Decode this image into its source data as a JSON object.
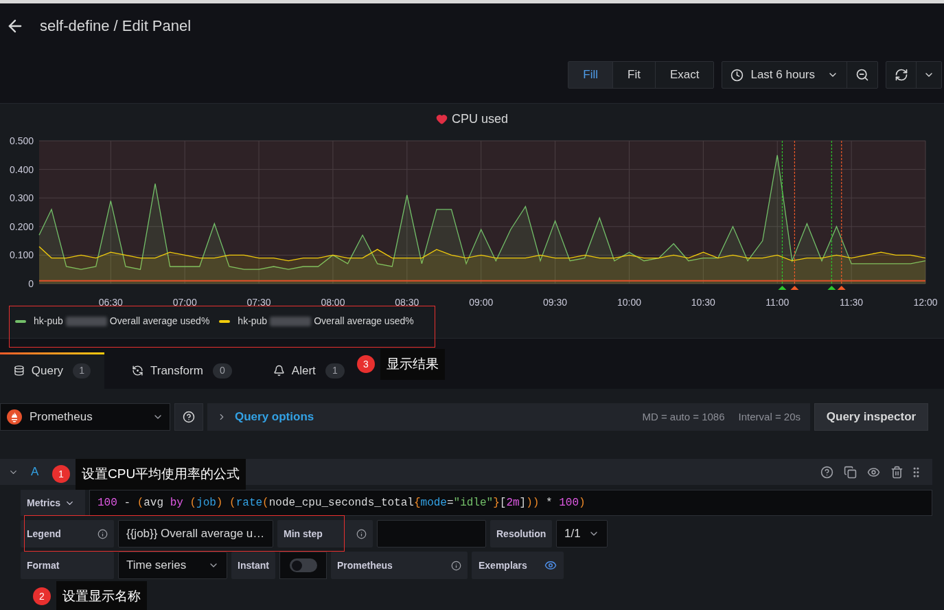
{
  "header": {
    "title": "self-define / Edit Panel"
  },
  "toolbar": {
    "display_modes": [
      {
        "label": "Fill",
        "selected": true
      },
      {
        "label": "Fit",
        "selected": false
      },
      {
        "label": "Exact",
        "selected": false
      }
    ],
    "time_range": "Last 6 hours"
  },
  "panel": {
    "title": "CPU used",
    "chart_data": {
      "type": "area",
      "ylim": [
        0,
        0.5
      ],
      "yticks": [
        {
          "value": 0,
          "label": "0"
        },
        {
          "value": 0.1,
          "label": "0.100"
        },
        {
          "value": 0.2,
          "label": "0.200"
        },
        {
          "value": 0.3,
          "label": "0.300"
        },
        {
          "value": 0.4,
          "label": "0.400"
        },
        {
          "value": 0.5,
          "label": "0.500"
        }
      ],
      "categories": [
        null,
        null,
        null,
        null,
        null,
        "06:30",
        null,
        null,
        null,
        null,
        "07:00",
        null,
        null,
        null,
        null,
        "07:30",
        null,
        null,
        null,
        null,
        "08:00",
        null,
        null,
        null,
        null,
        "08:30",
        null,
        null,
        null,
        null,
        "09:00",
        null,
        null,
        null,
        null,
        "09:30",
        null,
        null,
        null,
        null,
        "10:00",
        null,
        null,
        null,
        null,
        "10:30",
        null,
        null,
        null,
        null,
        "11:00",
        null,
        null,
        null,
        null,
        "11:30",
        null,
        null,
        null,
        null,
        "12:00"
      ],
      "grid": true,
      "ref_lines": [
        {
          "value": 0.01,
          "axis": "y"
        }
      ],
      "annotations": [
        {
          "x": "11:02"
        },
        {
          "x": "11:07"
        },
        {
          "x": "11:22"
        },
        {
          "x": "11:26"
        }
      ],
      "series": [
        {
          "name": "hk-pub",
          "color": "#73bf69",
          "values": [
            0.17,
            0.26,
            0.06,
            0.05,
            0.06,
            0.29,
            0.06,
            0.05,
            0.35,
            0.06,
            0.06,
            0.06,
            0.21,
            0.06,
            0.05,
            0.05,
            0.06,
            0.05,
            0.06,
            0.06,
            0.1,
            0.07,
            0.17,
            0.07,
            0.06,
            0.31,
            0.07,
            0.26,
            0.26,
            0.07,
            0.19,
            0.08,
            0.19,
            0.27,
            0.08,
            0.22,
            0.08,
            0.09,
            0.23,
            0.08,
            0.11,
            0.08,
            0.09,
            0.14,
            0.08,
            0.09,
            0.09,
            0.2,
            0.08,
            0.15,
            0.45,
            0.08,
            0.21,
            0.08,
            0.2,
            0.07,
            0.07,
            0.07,
            0.07,
            0.07,
            0.08
          ]
        },
        {
          "name": "hk-pub",
          "color": "#f2cc0c",
          "values": [
            0.13,
            0.09,
            0.09,
            0.1,
            0.09,
            0.11,
            0.1,
            0.09,
            0.09,
            0.11,
            0.1,
            0.09,
            0.09,
            0.1,
            0.1,
            0.09,
            0.09,
            0.08,
            0.09,
            0.09,
            0.1,
            0.09,
            0.09,
            0.12,
            0.09,
            0.09,
            0.09,
            0.12,
            0.1,
            0.09,
            0.1,
            0.09,
            0.09,
            0.09,
            0.1,
            0.09,
            0.09,
            0.1,
            0.09,
            0.09,
            0.1,
            0.09,
            0.09,
            0.1,
            0.09,
            0.11,
            0.09,
            0.1,
            0.09,
            0.09,
            0.1,
            0.08,
            0.09,
            0.09,
            0.1,
            0.09,
            0.1,
            0.11,
            0.1,
            0.1,
            0.09
          ]
        }
      ]
    },
    "legend_suffixes": [
      "Overall average used%",
      "Overall average used%"
    ]
  },
  "tabs": [
    {
      "kind": "query",
      "label": "Query",
      "count": "1",
      "selected": true
    },
    {
      "kind": "transform",
      "label": "Transform",
      "count": "0",
      "selected": false
    },
    {
      "kind": "alert",
      "label": "Alert",
      "count": "1",
      "selected": false
    }
  ],
  "query_bar": {
    "datasource": "Prometheus",
    "options_label": "Query options",
    "md": "MD = auto = 1086",
    "interval": "Interval = 20s",
    "inspector": "Query inspector"
  },
  "query": {
    "ref": "A",
    "expanded": true,
    "metrics_label": "Metrics",
    "tokens": [
      {
        "kind": "number",
        "text": "100"
      },
      {
        "kind": "plain",
        "text": " - "
      },
      {
        "kind": "paren",
        "text": "("
      },
      {
        "kind": "plain",
        "text": "avg "
      },
      {
        "kind": "keyword",
        "text": "by"
      },
      {
        "kind": "paren",
        "text": " ("
      },
      {
        "kind": "label",
        "text": "job"
      },
      {
        "kind": "paren",
        "text": ")"
      },
      {
        "kind": "paren",
        "text": " ("
      },
      {
        "kind": "label",
        "text": "rate"
      },
      {
        "kind": "paren",
        "text": "("
      },
      {
        "kind": "plain",
        "text": "node_cpu_seconds_total"
      },
      {
        "kind": "paren",
        "text": "{"
      },
      {
        "kind": "label",
        "text": "mode"
      },
      {
        "kind": "plain",
        "text": "="
      },
      {
        "kind": "string",
        "text": "\"idle\""
      },
      {
        "kind": "paren",
        "text": "}"
      },
      {
        "kind": "plain",
        "text": "["
      },
      {
        "kind": "number",
        "text": "2m"
      },
      {
        "kind": "plain",
        "text": "]"
      },
      {
        "kind": "paren",
        "text": "))"
      },
      {
        "kind": "plain",
        "text": " * "
      },
      {
        "kind": "number",
        "text": "100"
      },
      {
        "kind": "paren",
        "text": ")"
      }
    ],
    "legend": {
      "label": "Legend",
      "value": "{{job}} Overall average u…"
    },
    "min_step": {
      "label": "Min step"
    },
    "resolution": {
      "label": "Resolution",
      "value": "1/1"
    },
    "format": {
      "label": "Format",
      "value": "Time series"
    },
    "instant": {
      "label": "Instant",
      "on": false
    },
    "type": {
      "label": "Prometheus"
    },
    "exemplars": {
      "label": "Exemplars",
      "on": true
    }
  },
  "callouts": [
    {
      "number": "3",
      "text": "显示结果"
    },
    {
      "number": "1",
      "text": "设置CPU平均使用率的公式"
    },
    {
      "number": "2",
      "text": "设置显示名称"
    }
  ]
}
